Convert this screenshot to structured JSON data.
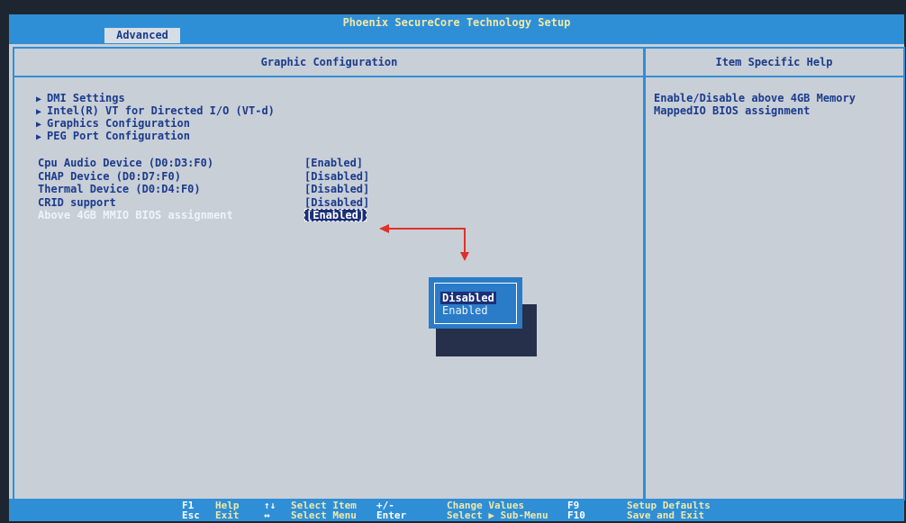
{
  "header": {
    "title": "Phoenix SecureCore Technology Setup",
    "tab": "Advanced"
  },
  "main": {
    "title": "Graphic Configuration",
    "submenus": [
      {
        "label": "DMI Settings"
      },
      {
        "label": "Intel(R) VT for Directed I/O (VT-d)"
      },
      {
        "label": "Graphics Configuration"
      },
      {
        "label": "PEG Port Configuration"
      }
    ],
    "settings": [
      {
        "label": "Cpu Audio Device (D0:D3:F0)",
        "value": "[Enabled]"
      },
      {
        "label": "CHAP Device (D0:D7:F0)",
        "value": "[Disabled]"
      },
      {
        "label": "Thermal Device (D0:D4:F0)",
        "value": "[Disabled]"
      },
      {
        "label": "CRID support",
        "value": "[Disabled]"
      },
      {
        "label": "Above 4GB MMIO BIOS assignment",
        "value": "[Enabled]"
      }
    ]
  },
  "popup": {
    "options": [
      "Disabled",
      "Enabled"
    ],
    "selected_index": 0
  },
  "help": {
    "title": "Item Specific Help",
    "lines": [
      "Enable/Disable above 4GB Memory",
      "MappedIO BIOS assignment"
    ]
  },
  "footer": {
    "row1": [
      {
        "key": "F1",
        "desc": "Help"
      },
      {
        "key": "↑↓",
        "desc": "Select Item"
      },
      {
        "key": "+/-",
        "desc": "Change Values"
      },
      {
        "key": "F9",
        "desc": "Setup Defaults"
      }
    ],
    "row2": [
      {
        "key": "Esc",
        "desc": "Exit"
      },
      {
        "key": "↔",
        "desc": "Select Menu"
      },
      {
        "key": "Enter",
        "desc": "Select ▶ Sub-Menu"
      },
      {
        "key": "F10",
        "desc": "Save and Exit"
      }
    ]
  },
  "colors": {
    "accent": "#2f8fd6",
    "text": "#1b3b8c",
    "header_text": "#f0e8a8",
    "callout": "#e0302a"
  }
}
